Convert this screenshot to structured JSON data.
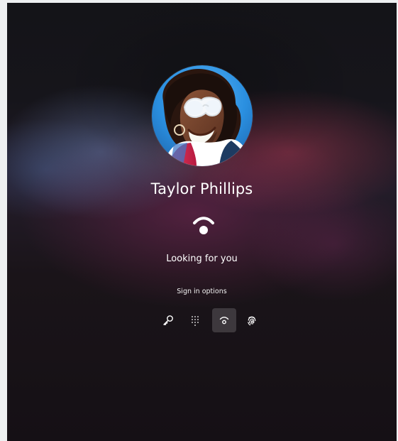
{
  "user": {
    "name": "Taylor Phillips",
    "avatar_icon": "user-avatar-photo"
  },
  "face_recognition": {
    "status": "Looking for you",
    "icon": "face-recognition-icon"
  },
  "sign_in": {
    "label": "Sign in options",
    "options": [
      {
        "icon": "key-icon",
        "selected": false
      },
      {
        "icon": "pin-icon",
        "selected": false
      },
      {
        "icon": "face-icon",
        "selected": true
      },
      {
        "icon": "fingerprint-icon",
        "selected": false
      }
    ]
  },
  "colors": {
    "text": "#ffffff",
    "selected_background": "rgba(255,255,255,0.16)"
  }
}
